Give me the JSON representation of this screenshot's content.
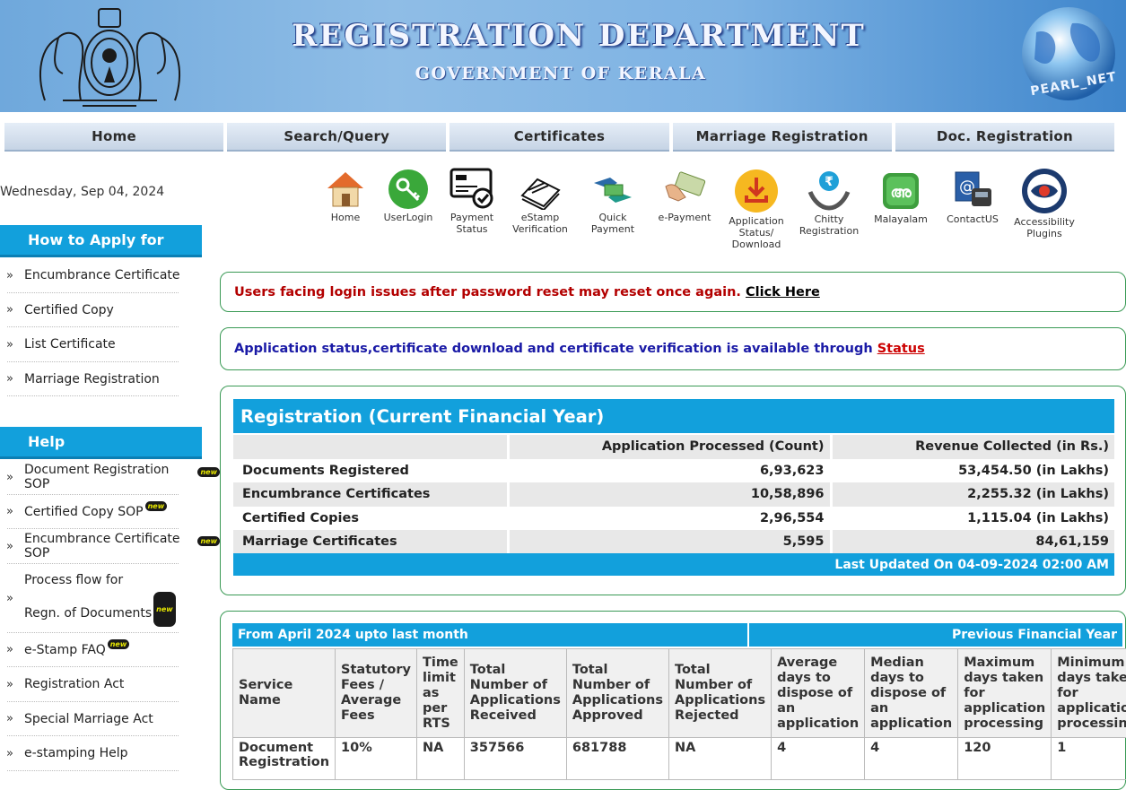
{
  "header": {
    "title": "REGISTRATION DEPARTMENT",
    "subtitle": "GOVERNMENT OF KERALA",
    "logo_text": "PEARL_NET"
  },
  "nav": [
    "Home",
    "Search/Query",
    "Certificates",
    "Marriage Registration",
    "Doc. Registration"
  ],
  "date": "Wednesday, Sep 04, 2024",
  "icons": [
    {
      "label": "Home",
      "icon": "home-icon"
    },
    {
      "label": "UserLogin",
      "icon": "key-icon"
    },
    {
      "label": "Payment Status",
      "icon": "payment-card-icon"
    },
    {
      "label": "eStamp Verification",
      "icon": "stamp-papers-icon"
    },
    {
      "label": "Quick Payment",
      "icon": "handshake-icon"
    },
    {
      "label": "e-Payment",
      "icon": "money-hand-icon"
    },
    {
      "label": "Application Status/ Download",
      "icon": "download-icon"
    },
    {
      "label": "Chitty Registration",
      "icon": "rupee-hands-icon"
    },
    {
      "label": "Malayalam",
      "icon": "malayalam-icon"
    },
    {
      "label": "ContactUS",
      "icon": "contact-icon"
    },
    {
      "label": "Accessibility Plugins",
      "icon": "eye-icon"
    }
  ],
  "how_to_apply": {
    "heading": "How to Apply for",
    "items": [
      "Encumbrance Certificate",
      "Certified Copy",
      "List Certificate",
      "Marriage Registration"
    ]
  },
  "help": {
    "heading": "Help",
    "items": [
      {
        "label": "Document Registration SOP",
        "new": true
      },
      {
        "label": "Certified Copy SOP",
        "new": true
      },
      {
        "label": "Encumbrance Certificate SOP",
        "new": true
      },
      {
        "label": "Process flow for",
        "label2": "Regn. of Documents",
        "new": true
      },
      {
        "label": "e-Stamp FAQ",
        "new": true
      },
      {
        "label": "Registration Act",
        "new": false
      },
      {
        "label": "Special Marriage Act",
        "new": false
      },
      {
        "label": "e-stamping Help",
        "new": false
      }
    ],
    "new_badge": "new"
  },
  "notices": {
    "login": {
      "text": "Users facing login issues after password reset may reset once again.",
      "link": "Click Here",
      "color": "#b30000"
    },
    "status": {
      "text": "Application status,certificate download and certificate verification is available through",
      "link": "Status",
      "color": "#1a1aa6",
      "link_color": "#cc0000"
    }
  },
  "registration": {
    "title": "Registration (Current Financial Year)",
    "col_count": "Application Processed (Count)",
    "col_revenue": "Revenue Collected (in Rs.)",
    "rows": [
      {
        "label": "Documents Registered",
        "count": "6,93,623",
        "revenue": "53,454.50 (in Lakhs)"
      },
      {
        "label": "Encumbrance Certificates",
        "count": "10,58,896",
        "revenue": "2,255.32 (in Lakhs)"
      },
      {
        "label": "Certified Copies",
        "count": "2,96,554",
        "revenue": "1,115.04 (in Lakhs)"
      },
      {
        "label": "Marriage Certificates",
        "count": "5,595",
        "revenue": "84,61,159"
      }
    ],
    "last_updated": "Last Updated On 04-09-2024 02:00 AM"
  },
  "service_table": {
    "left_header": "From April 2024 upto last month",
    "right_header": "Previous Financial Year",
    "columns": [
      "Service Name",
      "Statutory Fees / Average Fees",
      "Time limit as per RTS",
      "Total Number of Applications Received",
      "Total Number of Applications Approved",
      "Total Number of Applications Rejected",
      "Average days to dispose of an application",
      "Median days to dispose of an application",
      "Maximum days taken for application processing",
      "Minimum days taken for application processing"
    ],
    "rows": [
      [
        "Document Registration",
        "10%",
        "NA",
        "357566",
        "681788",
        "NA",
        "4",
        "4",
        "120",
        "1"
      ]
    ]
  },
  "colors": {
    "accent": "#12a0dc",
    "panel_border": "#3a9a55",
    "banner": "#7db2e3"
  }
}
